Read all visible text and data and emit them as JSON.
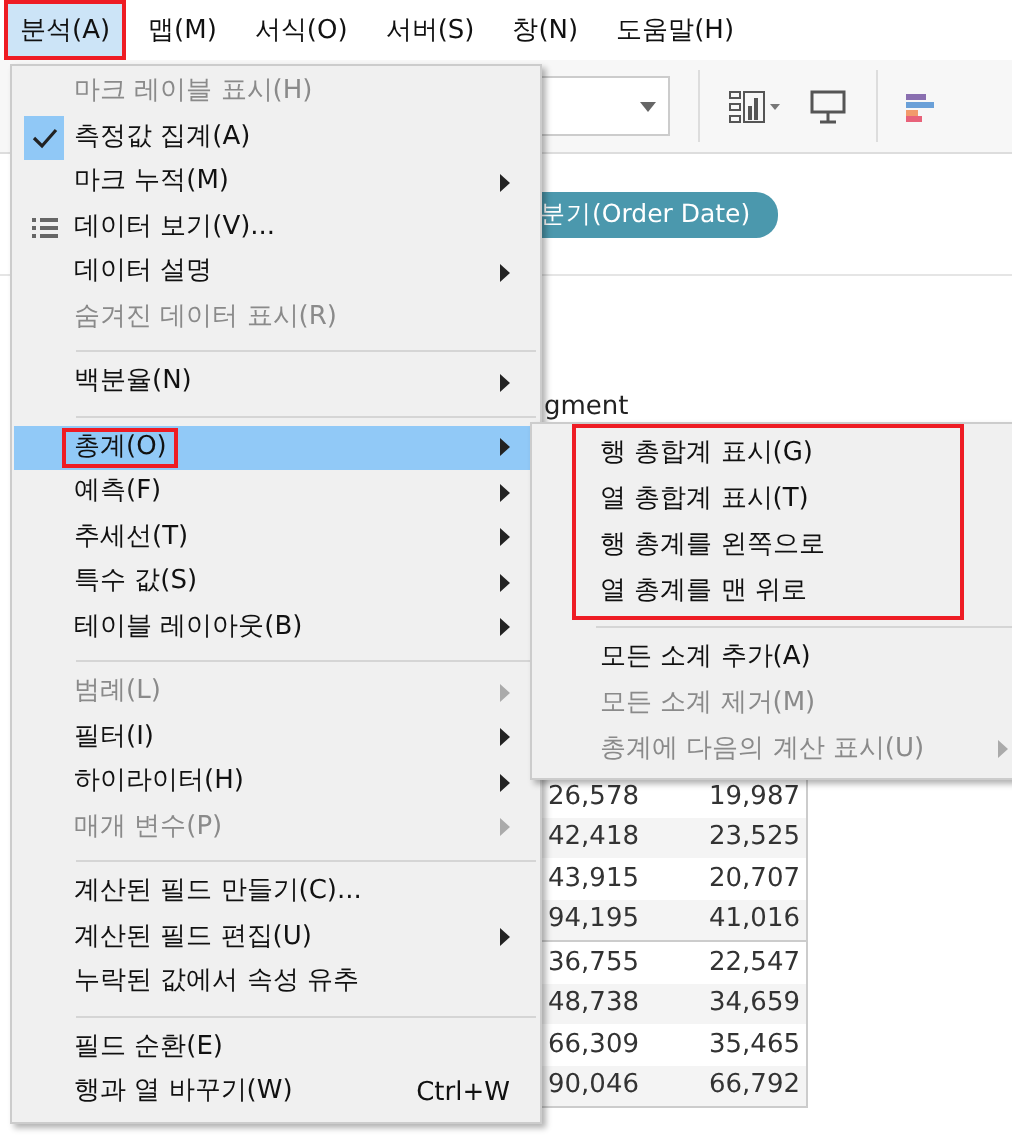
{
  "menubar": [
    {
      "label": "분석(A)",
      "selected": true,
      "annotated": true
    },
    {
      "label": "맵(M)",
      "selected": false,
      "annotated": false
    },
    {
      "label": "서식(O)",
      "selected": false,
      "annotated": false
    },
    {
      "label": "서버(S)",
      "selected": false,
      "annotated": false
    },
    {
      "label": "창(N)",
      "selected": false,
      "annotated": false
    },
    {
      "label": "도움말(H)",
      "selected": false,
      "annotated": false
    }
  ],
  "shelf_pill": "분기(Order Date)",
  "table": {
    "column_header": "gment",
    "rows": [
      [
        "26,578",
        "19,987"
      ],
      [
        "42,418",
        "23,525"
      ],
      [
        "43,915",
        "20,707"
      ],
      [
        "94,195",
        "41,016"
      ],
      [
        "36,755",
        "22,547"
      ],
      [
        "48,738",
        "34,659"
      ],
      [
        "66,309",
        "35,465"
      ],
      [
        "90,046",
        "66,792"
      ]
    ]
  },
  "menu": {
    "items": [
      {
        "kind": "item",
        "label": "마크 레이블 표시(H)",
        "disabled": true,
        "checked": false,
        "submenu": false,
        "selected": false,
        "annotated": false
      },
      {
        "kind": "item",
        "label": "측정값 집계(A)",
        "disabled": false,
        "checked": true,
        "submenu": false,
        "selected": false,
        "annotated": false
      },
      {
        "kind": "item",
        "label": "마크 누적(M)",
        "disabled": false,
        "checked": false,
        "submenu": true,
        "selected": false,
        "annotated": false
      },
      {
        "kind": "icon_item",
        "label": "데이터 보기(V)...",
        "disabled": false,
        "checked": false,
        "submenu": false,
        "selected": false,
        "annotated": false
      },
      {
        "kind": "item",
        "label": "데이터 설명",
        "disabled": false,
        "checked": false,
        "submenu": true,
        "selected": false,
        "annotated": false
      },
      {
        "kind": "item",
        "label": "숨겨진 데이터 표시(R)",
        "disabled": true,
        "checked": false,
        "submenu": false,
        "selected": false,
        "annotated": false
      },
      {
        "kind": "separator"
      },
      {
        "kind": "item",
        "label": "백분율(N)",
        "disabled": false,
        "checked": false,
        "submenu": true,
        "selected": false,
        "annotated": false
      },
      {
        "kind": "separator"
      },
      {
        "kind": "item",
        "label": "총계(O)",
        "disabled": false,
        "checked": false,
        "submenu": true,
        "selected": true,
        "annotated": true
      },
      {
        "kind": "item",
        "label": "예측(F)",
        "disabled": false,
        "checked": false,
        "submenu": true,
        "selected": false,
        "annotated": false
      },
      {
        "kind": "item",
        "label": "추세선(T)",
        "disabled": false,
        "checked": false,
        "submenu": true,
        "selected": false,
        "annotated": false
      },
      {
        "kind": "item",
        "label": "특수 값(S)",
        "disabled": false,
        "checked": false,
        "submenu": true,
        "selected": false,
        "annotated": false
      },
      {
        "kind": "item",
        "label": "테이블 레이아웃(B)",
        "disabled": false,
        "checked": false,
        "submenu": true,
        "selected": false,
        "annotated": false
      },
      {
        "kind": "separator"
      },
      {
        "kind": "item",
        "label": "범례(L)",
        "disabled": true,
        "checked": false,
        "submenu": true,
        "selected": false,
        "annotated": false
      },
      {
        "kind": "item",
        "label": "필터(I)",
        "disabled": false,
        "checked": false,
        "submenu": true,
        "selected": false,
        "annotated": false
      },
      {
        "kind": "item",
        "label": "하이라이터(H)",
        "disabled": false,
        "checked": false,
        "submenu": true,
        "selected": false,
        "annotated": false
      },
      {
        "kind": "item",
        "label": "매개 변수(P)",
        "disabled": true,
        "checked": false,
        "submenu": true,
        "selected": false,
        "annotated": false
      },
      {
        "kind": "separator"
      },
      {
        "kind": "item",
        "label": "계산된 필드 만들기(C)...",
        "disabled": false,
        "checked": false,
        "submenu": false,
        "selected": false,
        "annotated": false
      },
      {
        "kind": "item",
        "label": "계산된 필드 편집(U)",
        "disabled": false,
        "checked": false,
        "submenu": true,
        "selected": false,
        "annotated": false
      },
      {
        "kind": "item",
        "label": "누락된 값에서 속성 유추",
        "disabled": false,
        "checked": false,
        "submenu": false,
        "selected": false,
        "annotated": false
      },
      {
        "kind": "separator"
      },
      {
        "kind": "item",
        "label": "필드 순환(E)",
        "disabled": false,
        "checked": false,
        "submenu": false,
        "selected": false,
        "annotated": false
      },
      {
        "kind": "item",
        "label": "행과 열 바꾸기(W)",
        "shortcut": "Ctrl+W",
        "disabled": false,
        "checked": false,
        "submenu": false,
        "selected": false,
        "annotated": false
      }
    ]
  },
  "submenu": {
    "highlighted_items": [
      {
        "label": "행 총합계 표시(G)",
        "disabled": false,
        "submenu": false
      },
      {
        "label": "열 총합계 표시(T)",
        "disabled": false,
        "submenu": false
      },
      {
        "label": "행 총계를 왼쪽으로",
        "disabled": false,
        "submenu": false
      },
      {
        "label": "열 총계를 맨 위로",
        "disabled": false,
        "submenu": false
      }
    ],
    "items": [
      {
        "label": "모든 소계 추가(A)",
        "disabled": false,
        "submenu": false
      },
      {
        "label": "모든 소계 제거(M)",
        "disabled": true,
        "submenu": false
      },
      {
        "label": "총계에 다음의 계산 표시(U)",
        "disabled": true,
        "submenu": true
      }
    ]
  }
}
